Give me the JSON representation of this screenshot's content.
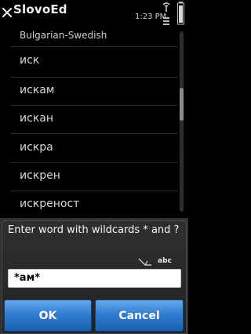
{
  "status_bar": {
    "app_title": "SlovoEd",
    "time": "1:23 PM"
  },
  "list": {
    "dictionary": "Bulgarian-Swedish",
    "items": [
      "иск",
      "искам",
      "искан",
      "искра",
      "искрен",
      "искреност"
    ]
  },
  "dialog": {
    "prompt": "Enter word with wildcards * and ?",
    "input_mode": "abc",
    "input_value": "*ам*",
    "ok_label": "OK",
    "cancel_label": "Cancel"
  },
  "colors": {
    "background": "#000000",
    "button_accent": "#2f7ed2"
  }
}
